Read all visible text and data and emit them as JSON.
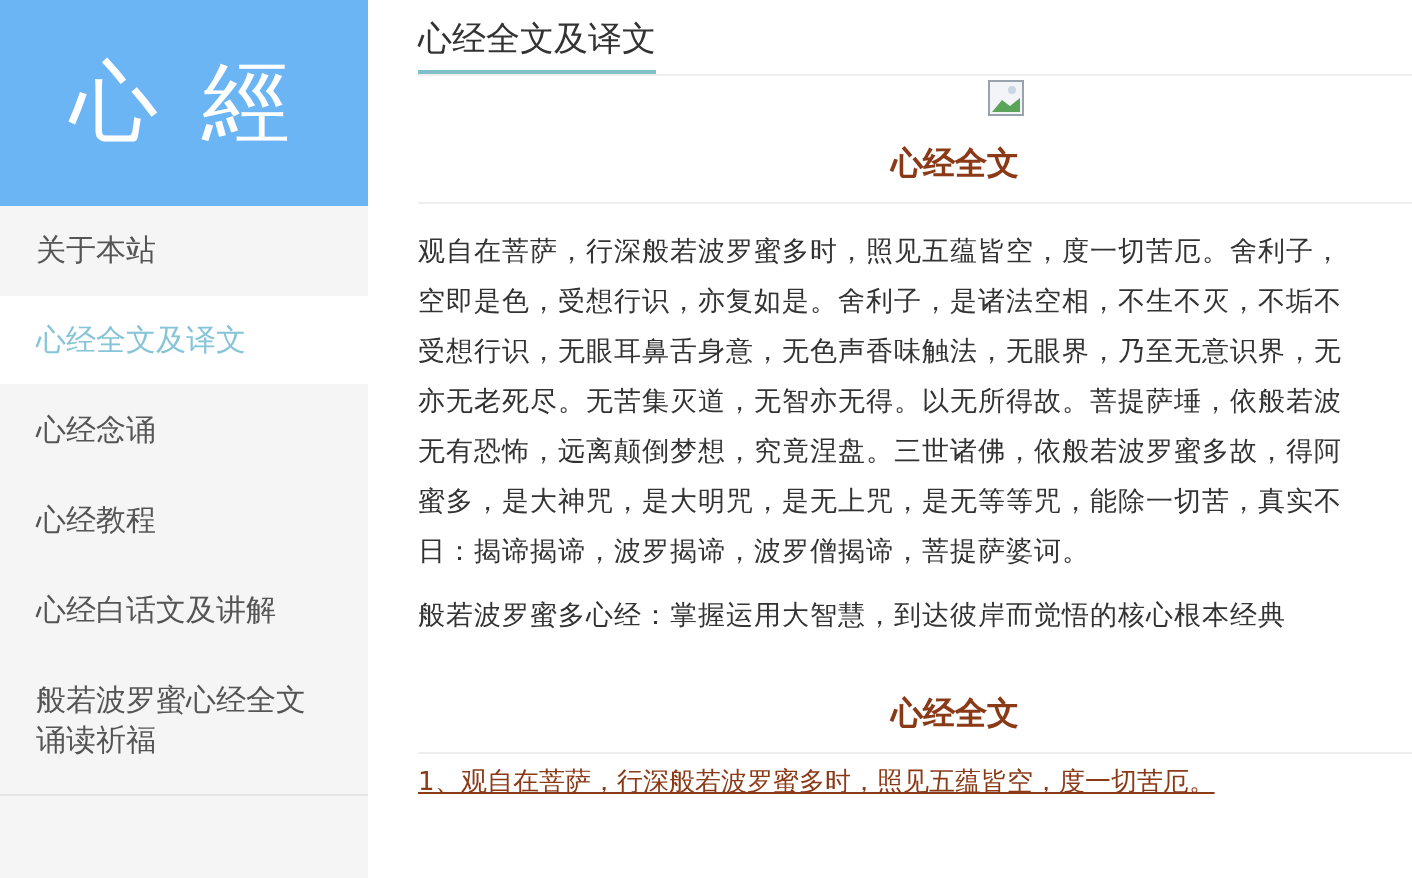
{
  "logo": "心 經",
  "sidebar": {
    "items": [
      {
        "label": "关于本站",
        "selected": false
      },
      {
        "label": "心经全文及译文",
        "selected": true
      },
      {
        "label": "心经念诵",
        "selected": false
      },
      {
        "label": "心经教程",
        "selected": false
      },
      {
        "label": "心经白话文及讲解",
        "selected": false
      },
      {
        "label": "般若波罗蜜心经全文诵读祈福",
        "selected": false
      }
    ]
  },
  "page_title": "心经全文及译文",
  "sections": [
    {
      "heading": "心经全文",
      "lines": [
        "观自在菩萨，行深般若波罗蜜多时，照见五蕴皆空，度一切苦厄。舍利子，",
        "空即是色，受想行识，亦复如是。舍利子，是诸法空相，不生不灭，不垢不",
        "受想行识，无眼耳鼻舌身意，无色声香味触法，无眼界，乃至无意识界，无",
        "亦无老死尽。无苦集灭道，无智亦无得。以无所得故。菩提萨埵，依般若波",
        "无有恐怖，远离颠倒梦想，究竟涅盘。三世诸佛，依般若波罗蜜多故，得阿",
        "蜜多，是大神咒，是大明咒，是无上咒，是无等等咒，能除一切苦，真实不",
        "日：揭谛揭谛，波罗揭谛，波罗僧揭谛，菩提萨婆诃。"
      ],
      "summary": "般若波罗蜜多心经：掌握运用大智慧，到达彼岸而觉悟的核心根本经典"
    },
    {
      "heading": "心经全文",
      "lines": [
        "1、观自在菩萨，行深般若波罗蜜多时，照见五蕴皆空，度一切苦厄。"
      ]
    }
  ]
}
